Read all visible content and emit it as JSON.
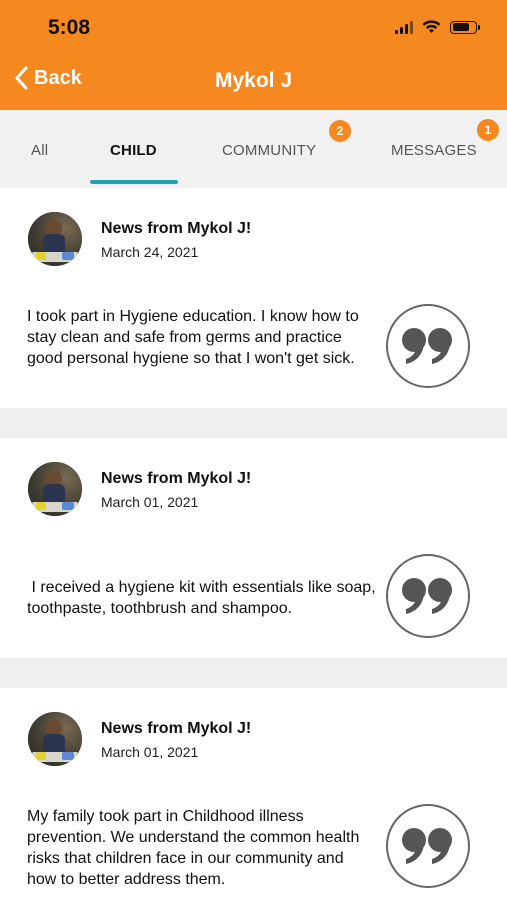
{
  "status_bar": {
    "time": "5:08"
  },
  "nav": {
    "back_label": "Back",
    "title": "Mykol J",
    "accent_color": "#f5881f"
  },
  "tabs": [
    {
      "label": "All",
      "active": false
    },
    {
      "label": "CHILD",
      "active": true
    },
    {
      "label": "COMMUNITY",
      "active": false,
      "badge": "2"
    },
    {
      "label": "MESSAGES",
      "active": false,
      "badge": "1"
    }
  ],
  "feed": [
    {
      "title": "News from Mykol J!",
      "date": "March 24, 2021",
      "body": "I took part in  Hygiene education.  I know how to stay clean and safe from germs and practice good personal hygiene so that I won't get sick.",
      "icon": "quote-icon"
    },
    {
      "title": "News from Mykol J!",
      "date": "March 01, 2021",
      "body": " I received a hygiene kit with essentials like soap, toothpaste, toothbrush and shampoo.",
      "icon": "quote-icon"
    },
    {
      "title": "News from Mykol J!",
      "date": "March 01, 2021",
      "body": "My family took part in  Childhood illness prevention.  We understand the common health risks that children face in our community and how to better address them.",
      "icon": "quote-icon"
    }
  ],
  "colors": {
    "tab_underline": "#1fa3b3",
    "badge": "#f5881f",
    "separator": "#efefef"
  }
}
